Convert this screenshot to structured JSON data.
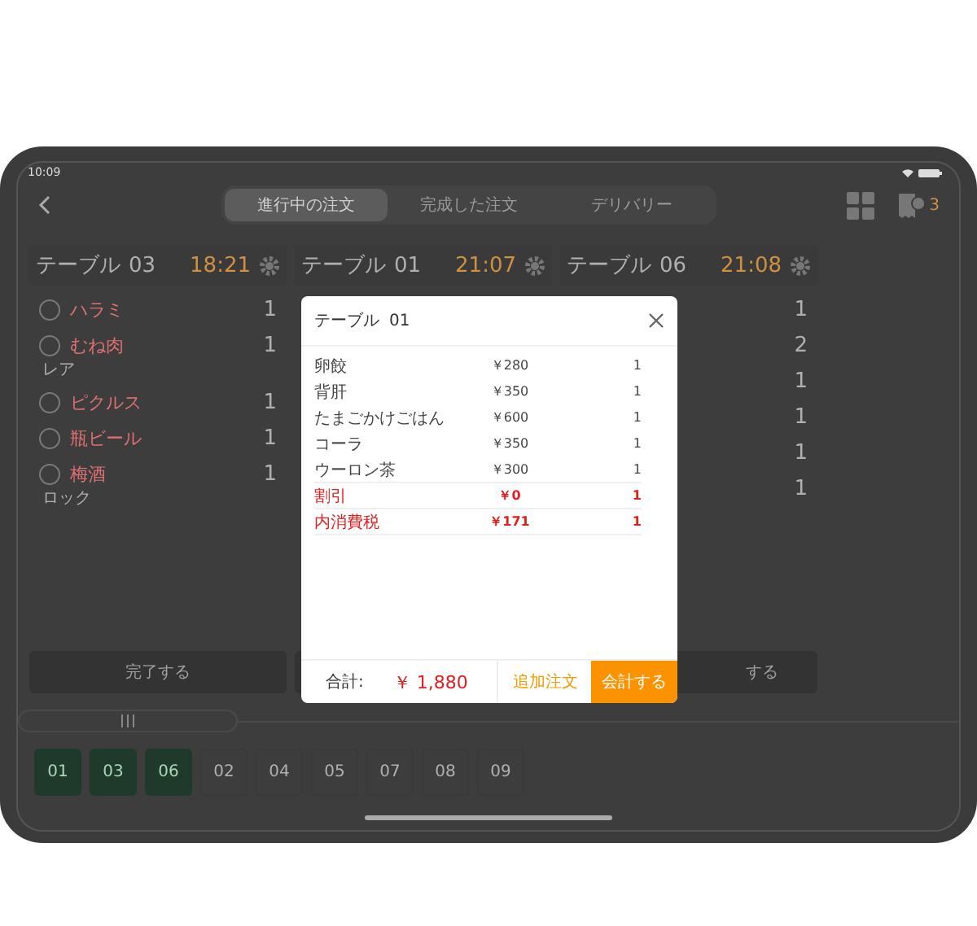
{
  "status_bar": {
    "time": "10:09"
  },
  "nav": {
    "tabs": [
      {
        "label": "進行中の注文",
        "selected": true
      },
      {
        "label": "完成した注文",
        "selected": false
      },
      {
        "label": "デリバリー",
        "selected": false
      }
    ],
    "badge": "3"
  },
  "orders": [
    {
      "title": "テーブル",
      "number": "03",
      "time": "18:21",
      "items": [
        {
          "name": "ハラミ",
          "qty": "1"
        },
        {
          "name": "むね肉",
          "qty": "1",
          "note": "レア"
        },
        {
          "name": "ピクルス",
          "qty": "1"
        },
        {
          "name": "瓶ビール",
          "qty": "1"
        },
        {
          "name": "梅酒",
          "qty": "1",
          "note": "ロック"
        }
      ],
      "button": "完了する"
    },
    {
      "title": "テーブル",
      "number": "01",
      "time": "21:07"
    },
    {
      "title": "テーブル",
      "number": "06",
      "time": "21:08",
      "items": [
        {
          "qty": "1"
        },
        {
          "qty": "2"
        },
        {
          "qty": "1"
        },
        {
          "qty": "1"
        },
        {
          "qty": "1"
        },
        {
          "qty": "1"
        }
      ],
      "button": "する"
    }
  ],
  "tables": [
    {
      "label": "01",
      "selected": true
    },
    {
      "label": "03",
      "selected": true
    },
    {
      "label": "06",
      "selected": true
    },
    {
      "label": "02",
      "selected": false
    },
    {
      "label": "04",
      "selected": false
    },
    {
      "label": "05",
      "selected": false
    },
    {
      "label": "07",
      "selected": false
    },
    {
      "label": "08",
      "selected": false
    },
    {
      "label": "09",
      "selected": false
    }
  ],
  "modal": {
    "title": "テーブル",
    "number": "01",
    "rows": [
      {
        "kind": "item",
        "name": "卵餃",
        "price": "￥280",
        "qty": "1"
      },
      {
        "kind": "item",
        "name": "背肝",
        "price": "￥350",
        "qty": "1"
      },
      {
        "kind": "item",
        "name": "たまごかけごはん",
        "price": "￥600",
        "qty": "1"
      },
      {
        "kind": "item",
        "name": "コーラ",
        "price": "￥350",
        "qty": "1"
      },
      {
        "kind": "item",
        "name": "ウーロン茶",
        "price": "￥300",
        "qty": "1"
      },
      {
        "kind": "adjustment",
        "name": "割引",
        "price": "￥0",
        "qty": "1"
      },
      {
        "kind": "adjustment",
        "name": "内消費税",
        "price": "￥171",
        "qty": "1"
      }
    ],
    "total_label": "合計:",
    "total": "￥ 1,880",
    "add_button": "追加注文",
    "checkout_button": "会計する"
  }
}
